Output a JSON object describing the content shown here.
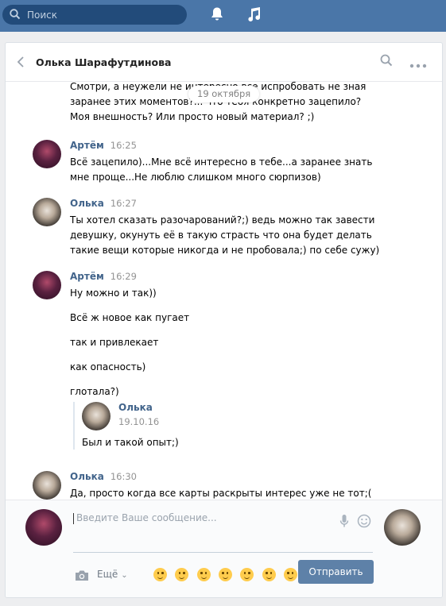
{
  "topbar": {
    "search_placeholder": "Поиск",
    "icons": [
      "search-icon",
      "bell-icon",
      "music-icon"
    ],
    "color": "#4a76a8"
  },
  "dialog": {
    "title": "Олька Шарафутдинова",
    "date_badge": "19 октября"
  },
  "messages": [
    {
      "lines": [
        "Смотри, а неужели не интересно все испробовать не зная",
        "заранее этих моментов?... что тебя конкретно зацепило?",
        "Моя внешность? Или просто новый материал? ;)"
      ]
    },
    {
      "author": "Артём",
      "time": "16:25",
      "lines": [
        "Всё зацепило)...Мне всё интересно в тебе...а заранее знать",
        "мне проще...Не люблю слишком много сюрпизов)"
      ]
    },
    {
      "author": "Олька",
      "time": "16:27",
      "lines": [
        "Ты хотел сказать разочарований?;) ведь можно так завести",
        "девушку, окунуть её в такую страсть что она будет делать",
        "такие вещи которые никогда и не пробовала;) по себе сужу)"
      ]
    },
    {
      "author": "Артём",
      "time": "16:29",
      "lines": [
        "Ну можно и так))",
        "Всё ж новое как пугает",
        "так и привлекает",
        "как опасность)",
        "глотала?)"
      ],
      "forwarded": {
        "author": "Олька",
        "date": "19.10.16",
        "text": "Был и такой опыт;)"
      }
    },
    {
      "author": "Олька",
      "time": "16:30",
      "lines": [
        "Да, просто когда все карты раскрыты интерес уже не тот;("
      ]
    }
  ],
  "composer": {
    "placeholder": "Введите Ваше сообщение...",
    "more_label": "Ещё",
    "send_label": "Отправить",
    "send_color": "#5e81a8"
  }
}
